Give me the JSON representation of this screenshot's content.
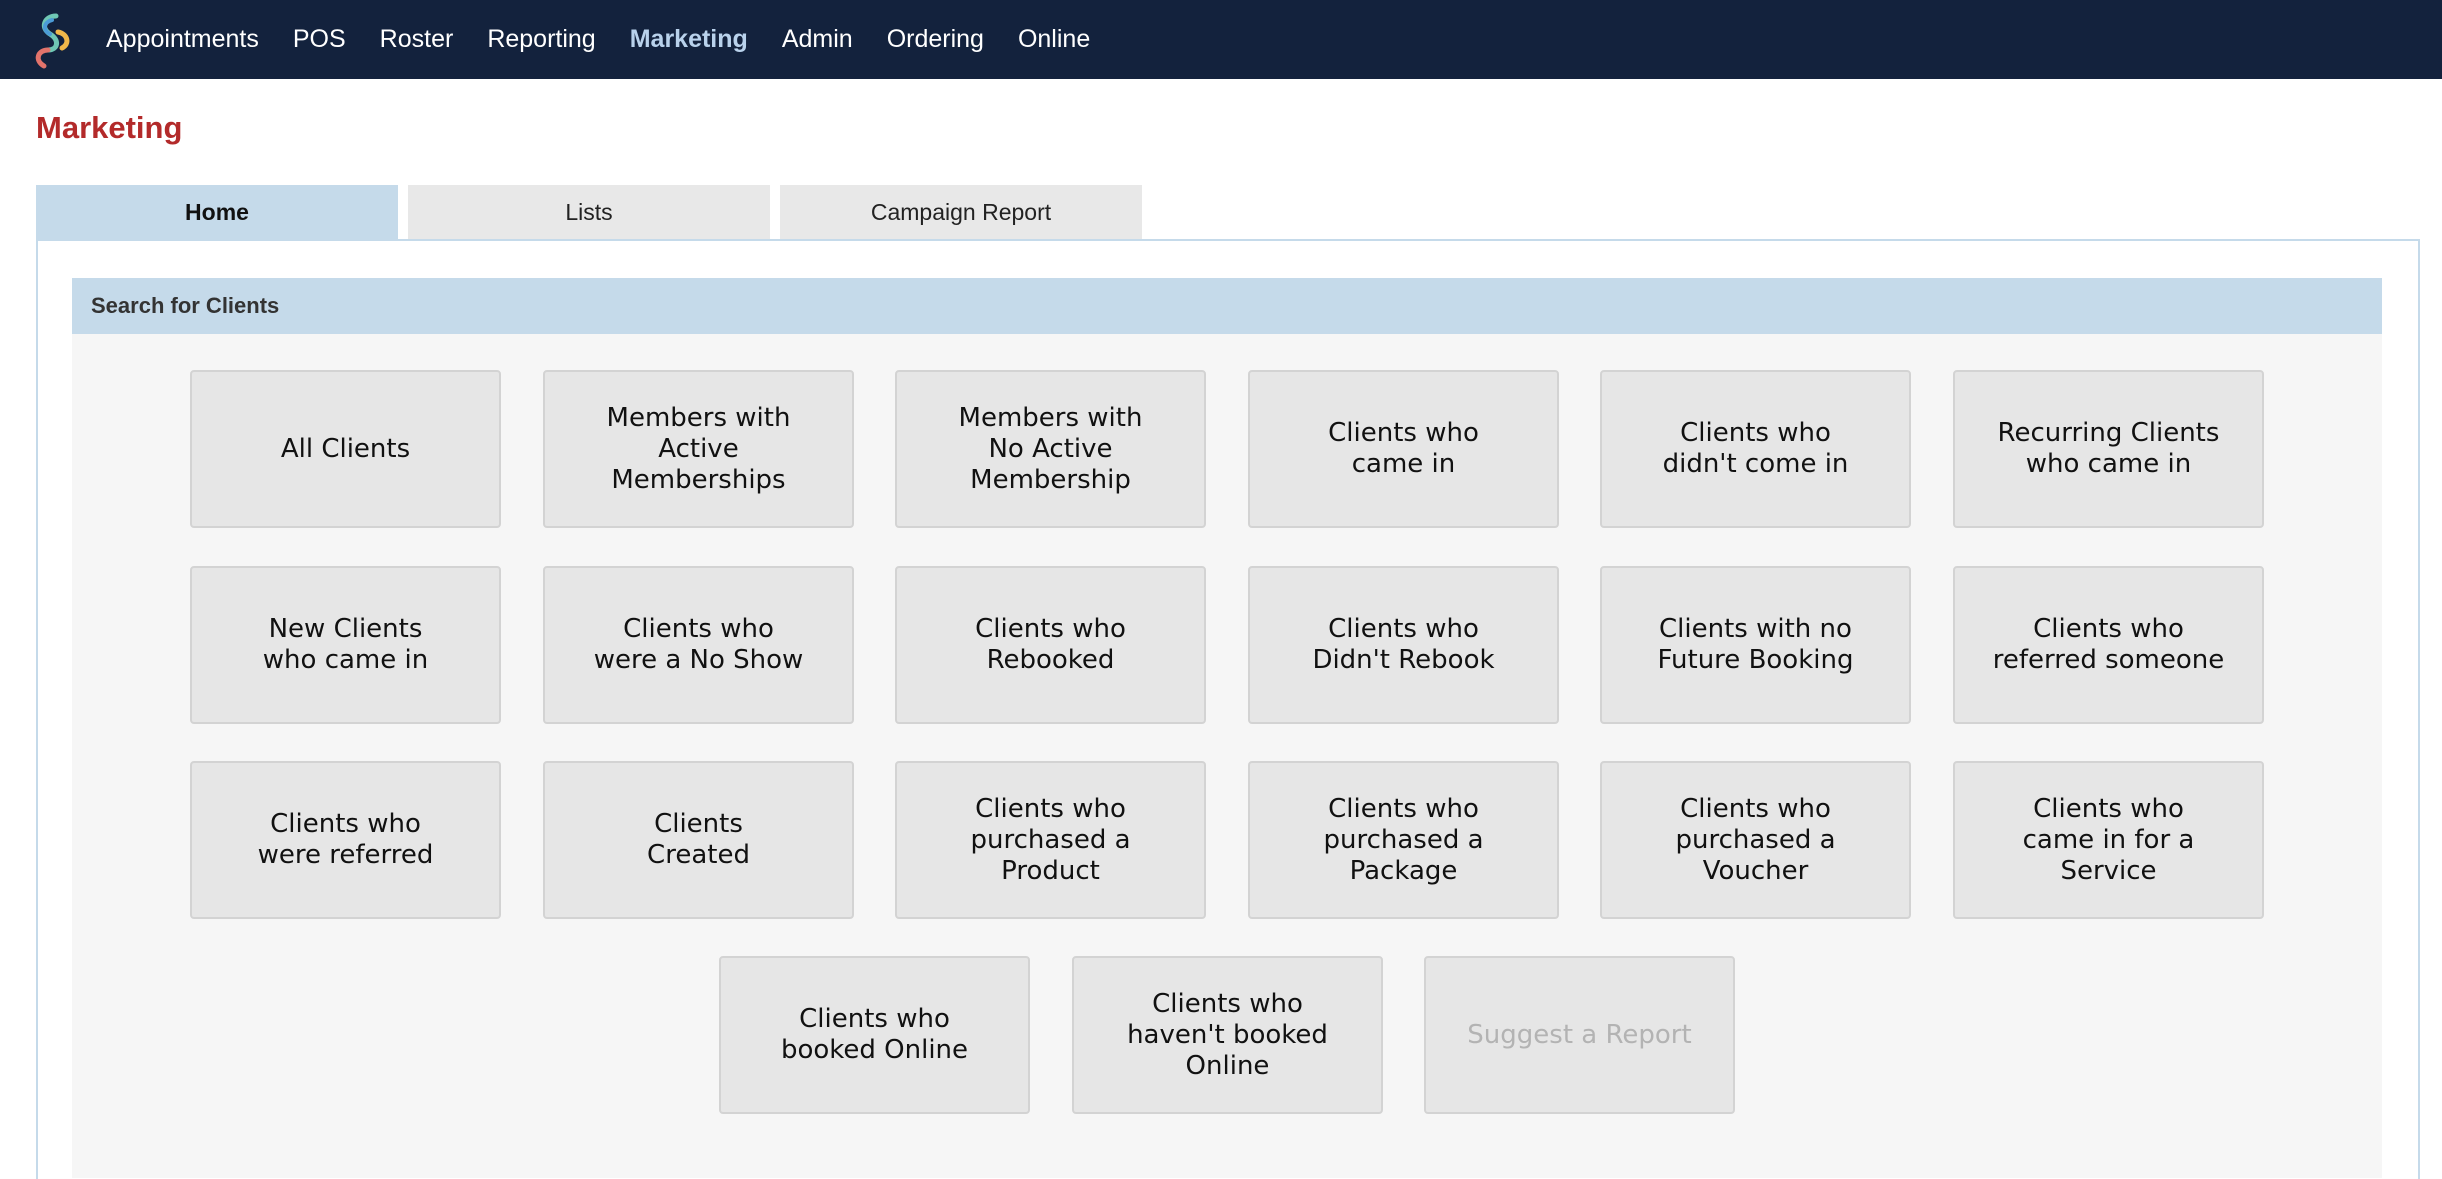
{
  "nav": {
    "items": [
      {
        "label": "Appointments",
        "active": false
      },
      {
        "label": "POS",
        "active": false
      },
      {
        "label": "Roster",
        "active": false
      },
      {
        "label": "Reporting",
        "active": false
      },
      {
        "label": "Marketing",
        "active": true
      },
      {
        "label": "Admin",
        "active": false
      },
      {
        "label": "Ordering",
        "active": false
      },
      {
        "label": "Online",
        "active": false
      }
    ]
  },
  "page": {
    "title": "Marketing"
  },
  "tabs": [
    {
      "label": "Home",
      "active": true
    },
    {
      "label": "Lists",
      "active": false
    },
    {
      "label": "Campaign Report",
      "active": false
    }
  ],
  "search": {
    "header": "Search for Clients",
    "tiles": [
      {
        "label": "All Clients"
      },
      {
        "label": "Members with\nActive\nMemberships"
      },
      {
        "label": "Members with\nNo Active\nMembership"
      },
      {
        "label": "Clients who\ncame in"
      },
      {
        "label": "Clients who\ndidn't come in"
      },
      {
        "label": "Recurring Clients\nwho came in"
      },
      {
        "label": "New Clients\nwho came in"
      },
      {
        "label": "Clients who\nwere a No Show"
      },
      {
        "label": "Clients who\nRebooked"
      },
      {
        "label": "Clients who\nDidn't Rebook"
      },
      {
        "label": "Clients with no\nFuture Booking"
      },
      {
        "label": "Clients who\nreferred someone"
      },
      {
        "label": "Clients who\nwere referred"
      },
      {
        "label": "Clients\nCreated"
      },
      {
        "label": "Clients who\npurchased a\nProduct"
      },
      {
        "label": "Clients who\npurchased a\nPackage"
      },
      {
        "label": "Clients who\npurchased a\nVoucher"
      },
      {
        "label": "Clients who\ncame in for a\nService"
      },
      {
        "label": "Clients who\nbooked Online"
      },
      {
        "label": "Clients who\nhaven't booked\nOnline"
      },
      {
        "label": "Suggest a Report",
        "disabled": true
      }
    ]
  },
  "colors": {
    "topbar": "#13223d",
    "nav_active": "#b9d2ec",
    "title": "#b32a2a",
    "tab_active": "#c5daea",
    "tile_bg": "#e6e6e6"
  }
}
